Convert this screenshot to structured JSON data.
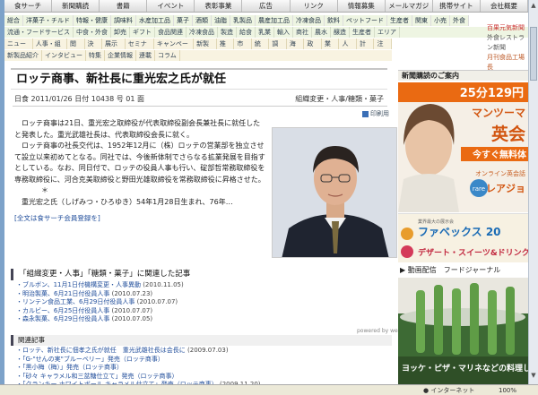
{
  "nav_primary": [
    "食サーチ",
    "新聞購読",
    "書籍",
    "イベント",
    "表彰事業",
    "広告",
    "リンク",
    "情報募集",
    "メールマガジン",
    "携帯サイト",
    "会社概要"
  ],
  "nav_secondary": [
    "総合",
    "洋菓子・チルド",
    "特報・健康",
    "調味料",
    "水産加工品",
    "菓子",
    "酒類",
    "油脂",
    "乳製品",
    "農産加工品",
    "冷凍食品",
    "飲料",
    "ペットフード",
    "生産者",
    "関東",
    "小売",
    "外食"
  ],
  "nav_tertiary": [
    "流通・フードサービス",
    "中食・外食",
    "卸売",
    "ギフト",
    "食品関連",
    "冷凍食品",
    "製造",
    "給食",
    "乳業",
    "輸入",
    "商社",
    "農水",
    "醸造",
    "生産者",
    "エリア"
  ],
  "nav_topics": [
    "ニュース",
    "人事・組織",
    "閲覧",
    "決算",
    "展示会",
    "セミナー",
    "キャンペーン",
    "新製品",
    "推移",
    "市況",
    "統計",
    "調査",
    "海外",
    "政策",
    "業界",
    "人事",
    "計報",
    "注目"
  ],
  "nav_special": [
    "新製品紹介",
    "インタビュー",
    "特集",
    "企業情報",
    "連載",
    "コラム"
  ],
  "right_sidebar_links": [
    "百果元気新聞",
    "外食レストラン新聞",
    "月刊食品工場長"
  ],
  "article": {
    "headline": "ロッテ商事、新社長に重光宏之氏が就任",
    "source": "日食 2011/01/26 日付 10438 号 01 面",
    "category": "組織変更・人事/糖類・菓子",
    "tools_label": "印刷用",
    "paragraphs": [
      "ロッテ商事は21日、重光宏之取締役が代表取締役副会長兼社長に就任したと発表した。重光武雄社長は、代表取締役会長に就く。",
      "ロッテ商事の社長交代は、1952年12月に（株）ロッテの営業部を独立させて設立以来初めてとなる。同社では、今後新体制でさらなる拡業発展を目指すとしている。なお、同日付で、ロッテの役員人事も行い、碇部哲常務取締役を専務取締役に、河合克美取締役と野田光雄取締役を常務取締役に昇格させた。",
      "＊",
      "重光宏之氏（しげみつ・ひろゆき）54年1月28日生まれ、76年…"
    ],
    "full_text_link": "[全文は食サーチ会員登録を]"
  },
  "related_category": {
    "title": "「組織変更・人事」「糖類・菓子」に関連した記事",
    "items": [
      {
        "title": "ブルボン、11月1日付機構変更・人事異動",
        "date": "(2010.11.05)"
      },
      {
        "title": "明治製菓、6月21日付役員人事",
        "date": "(2010.07.23)"
      },
      {
        "title": "リンテン食品工業、6月29日付役員人事",
        "date": "(2010.07.07)"
      },
      {
        "title": "カルビー、6月25日付役員人事",
        "date": "(2010.07.07)"
      },
      {
        "title": "森永製菓、6月29日付役員人事",
        "date": "(2010.07.05)"
      }
    ],
    "powered_by": "powered by weblio"
  },
  "related_articles": {
    "title": "関連記事",
    "items": [
      {
        "title": "ロッテ、新社長に佃孝之氏が就任　重光武雄社長は会長に",
        "date": "(2009.07.03)"
      },
      {
        "title": "「G-\"せんの実\"ブルーベリー」発売（ロッテ商事）",
        "date": ""
      },
      {
        "title": "「黒小梅（梅）」発売（ロッテ商事）",
        "date": ""
      },
      {
        "title": "「砂々 キャラメル和三盆糖仕立て」発売（ロッテ商事）",
        "date": ""
      },
      {
        "title": "「クランキー ホワイトボール キャラメル仕立て」発売（ロッテ商事）",
        "date": "(2009.11.20)"
      }
    ]
  },
  "sidebar": {
    "guide_title": "新聞購読のご案内",
    "ad_price": "25分129円",
    "ad_line2": "マンツーマ",
    "ad_brand": "英会",
    "ad_cta": "今すぐ無料体",
    "ad_online": "オンライン英会話",
    "ad_school": "レアジョ",
    "ad_logo": "rare",
    "event_small": "業界最大の展示会",
    "event_name": "ファベックス 20",
    "event_sub": "デザート・スイーツ&ドリンク",
    "video_label": "動画配信　フードジャーナル",
    "video_caption": "ヨッケ・ピザ・マリネなどの料理しよ"
  },
  "status_bar": {
    "zone": "インターネット",
    "zoom": "100%"
  }
}
